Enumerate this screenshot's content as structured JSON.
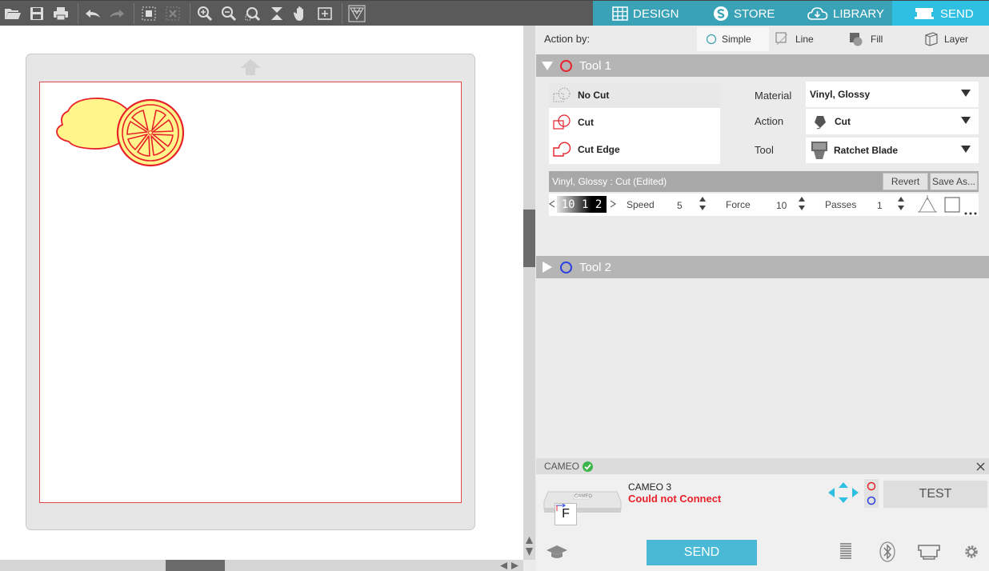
{
  "nav": {
    "design": "DESIGN",
    "store": "STORE",
    "library": "LIBRARY",
    "send": "SEND"
  },
  "toolbar_icons": [
    "open-icon",
    "save-icon",
    "print-icon",
    "undo-icon",
    "redo-icon",
    "group-icon",
    "ungroup-icon",
    "zoom-in-icon",
    "zoom-out-icon",
    "zoom-selection-icon",
    "zoom-fit-icon",
    "pan-hand-icon",
    "fit-page-icon",
    "triangle-pattern-icon"
  ],
  "action": {
    "label": "Action by:",
    "simple": "Simple",
    "line": "Line",
    "fill": "Fill",
    "layer": "Layer",
    "selected": "Simple"
  },
  "tool1": {
    "title": "Tool 1",
    "color": "#e8202a",
    "options": [
      "No Cut",
      "Cut",
      "Cut Edge"
    ],
    "selected_option": "No Cut",
    "material_label": "Material",
    "material_value": "Vinyl, Glossy",
    "action_label": "Action",
    "action_value": "Cut",
    "tool_label": "Tool",
    "tool_value": "Ratchet Blade",
    "preset_name": "Vinyl, Glossy : Cut (Edited)",
    "revert": "Revert",
    "save_as": "Save As...",
    "blade_scale": "10 1 2",
    "speed_label": "Speed",
    "speed_value": "5",
    "force_label": "Force",
    "force_value": "10",
    "passes_label": "Passes",
    "passes_value": "1"
  },
  "tool2": {
    "title": "Tool 2",
    "color": "#2a3fe0"
  },
  "device": {
    "header": "CAMEO",
    "name": "CAMEO 3",
    "status": "Could not Connect",
    "status_color": "#e8202a",
    "test": "TEST",
    "send": "SEND",
    "thumb_letter": "F",
    "thumb_text": "CAMEO"
  },
  "colors": {
    "accent": "#3aa2b6",
    "active_tab": "#2fbfe3",
    "lemon_fill": "#fff58a",
    "cut_line": "#e8202a"
  }
}
